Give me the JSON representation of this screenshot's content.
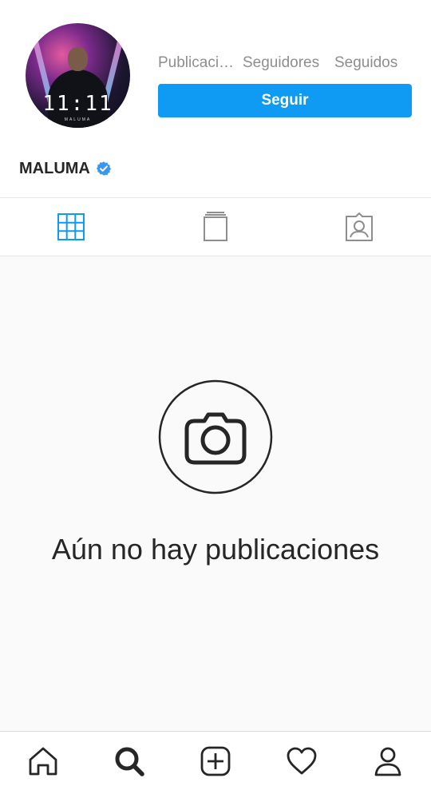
{
  "profile": {
    "username": "MALUMA",
    "avatar_album_title": "11:11",
    "avatar_album_artist": "MALUMA",
    "verified_icon": "verified-badge-icon"
  },
  "stats": {
    "posts_label": "Publicaciones",
    "followers_label": "Seguidores",
    "following_label": "Seguidos"
  },
  "follow_button": {
    "label": "Seguir"
  },
  "tabs": [
    {
      "name": "grid",
      "icon": "grid-icon",
      "active": true
    },
    {
      "name": "guide",
      "icon": "guide-icon",
      "active": false
    },
    {
      "name": "tagged",
      "icon": "tagged-person-icon",
      "active": false
    }
  ],
  "empty_state": {
    "icon": "camera-icon",
    "message": "Aún no hay publicaciones"
  },
  "bottom_nav": [
    {
      "name": "home",
      "icon": "home-icon"
    },
    {
      "name": "search",
      "icon": "search-icon",
      "active": true
    },
    {
      "name": "add",
      "icon": "add-post-icon"
    },
    {
      "name": "activity",
      "icon": "heart-icon"
    },
    {
      "name": "profile",
      "icon": "profile-icon"
    }
  ],
  "colors": {
    "accent": "#0f9af3",
    "text": "#262626",
    "muted": "#8e8e8e",
    "background": "#fafafa"
  }
}
